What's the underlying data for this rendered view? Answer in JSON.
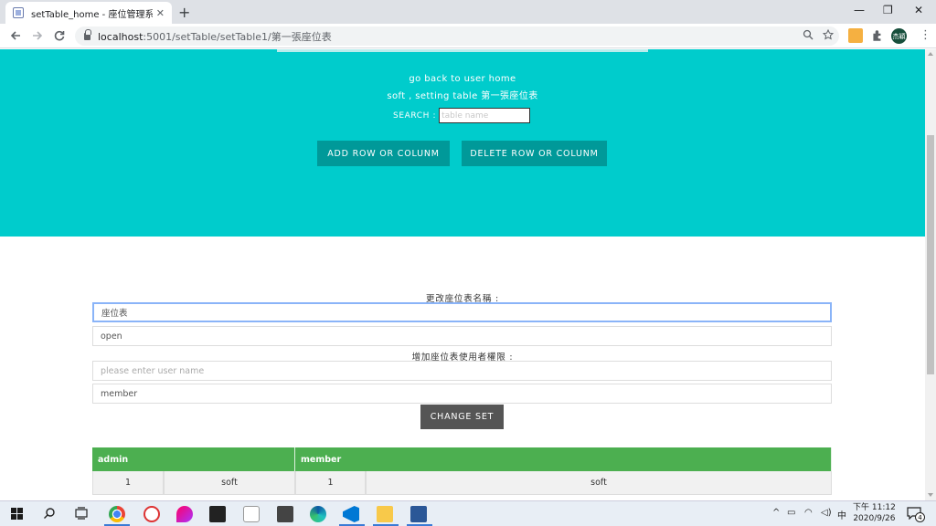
{
  "browser": {
    "tab_title": "setTable_home - 座位管理系統",
    "tab_close": "✕",
    "new_tab": "+",
    "url_host": "localhost",
    "url_rest": ":5001/setTable/setTable1/第一張座位表",
    "profile_label": "杰穎",
    "window_controls": {
      "minimize": "—",
      "restore": "❐",
      "close": "✕"
    }
  },
  "hero": {
    "back_link": "go back to user home",
    "subtitle": "soft , setting table 第一張座位表",
    "search_label": "SEARCH :",
    "search_placeholder": "table name",
    "add_button": "ADD ROW OR COLUNM",
    "delete_button": "DELETE ROW OR COLUNM",
    "background_color": "#00cccc"
  },
  "form": {
    "rename_label": "更改座位表名稱 :",
    "table_name_value": "座位表",
    "status_value": "open",
    "add_user_label": "增加座位表使用者權限 :",
    "user_name_placeholder": "please enter user name",
    "role_value": "member",
    "change_button": "CHANGE SET"
  },
  "table": {
    "headers": [
      "admin",
      "member"
    ],
    "rows": [
      [
        "1",
        "soft",
        "1",
        "soft"
      ]
    ],
    "header_color": "#4caf50"
  },
  "taskbar": {
    "time": "下午 11:12",
    "date": "2020/9/26",
    "ime": "中",
    "notification_count": "4"
  }
}
